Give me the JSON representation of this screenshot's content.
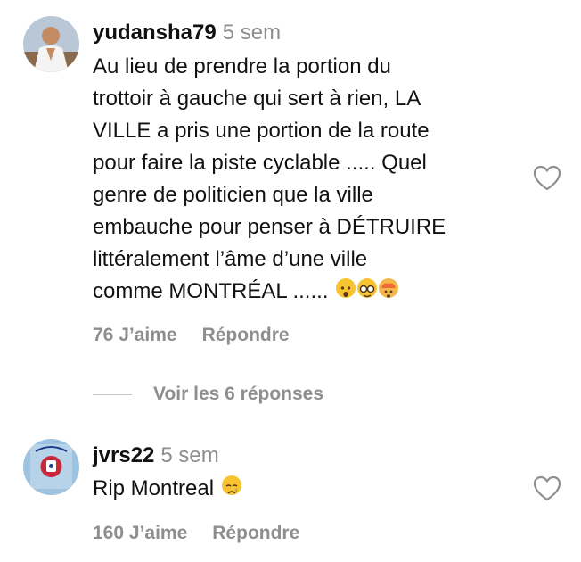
{
  "comments": [
    {
      "username": "yudansha79",
      "time": "5 sem",
      "text": "Au lieu de prendre la portion du\ntrottoir à gauche qui sert à rien, LA\nVILLE a pris une portion de la route\npour faire la piste cyclable ..... Quel\ngenre de politicien que la ville\nembauche pour penser à DÉTRUIRE\nlittéralement l’âme d’une ville\ncomme MONTRÉAL ......",
      "emojis": [
        "astonished-face",
        "nerd-face",
        "exploding-head"
      ],
      "likes": "76 J’aime",
      "reply": "Répondre"
    },
    {
      "username": "jvrs22",
      "time": "5 sem",
      "text": "Rip Montreal",
      "emojis": [
        "crying-face"
      ],
      "likes": "160 J’aime",
      "reply": "Répondre"
    }
  ],
  "view_replies": "Voir les 6 réponses",
  "colors": {
    "text": "#111111",
    "muted": "#8e8e8e",
    "divider": "#c7c7c7"
  }
}
